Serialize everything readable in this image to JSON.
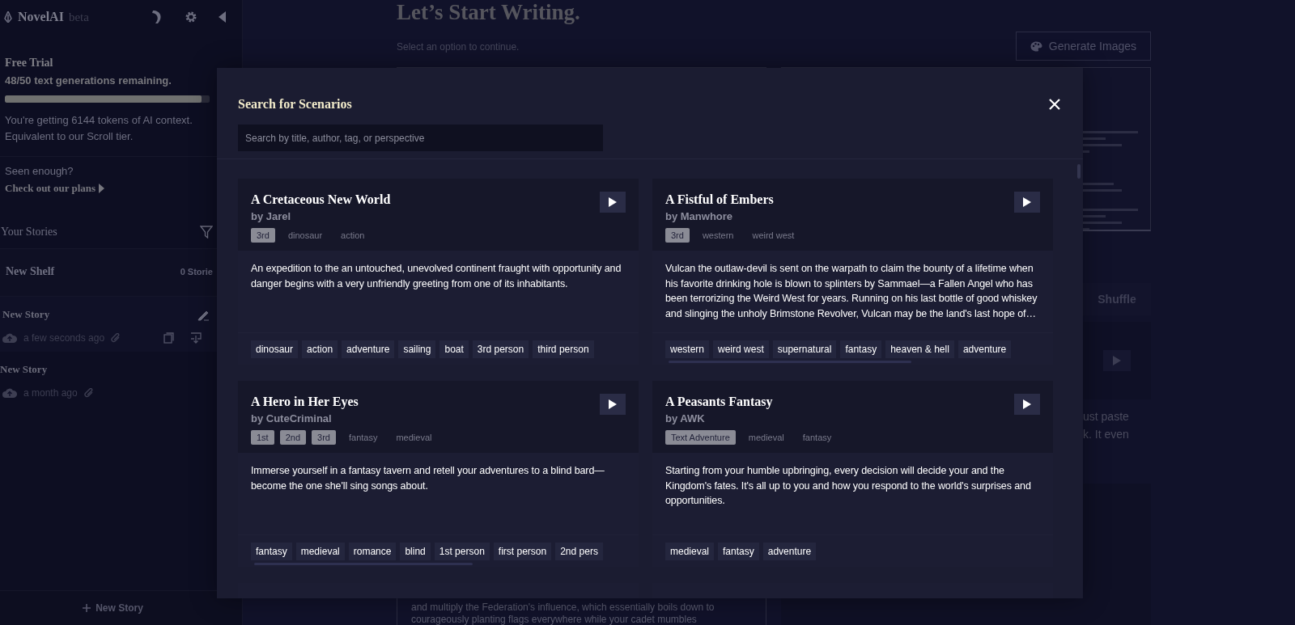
{
  "sidebar": {
    "brand": "NovelAI",
    "brand_badge": "beta",
    "trial": {
      "title": "Free Trial",
      "remaining": "48/50 text generations remaining.",
      "level": 0.96,
      "context": "You're getting 6144 tokens of AI context. Equivalent to our Scroll tier.",
      "prompt": "Seen enough?",
      "plans_link": "Check out our plans"
    },
    "stories_heading": "Your Stories",
    "shelf": {
      "name": "New Shelf",
      "count": "0 Storie"
    },
    "stories": [
      {
        "title": "New Story",
        "time": "a few seconds ago",
        "selected": true
      },
      {
        "title": "New Story",
        "time": "a month ago",
        "selected": false
      }
    ],
    "new_story_button": "New Story"
  },
  "main": {
    "title": "Let’s Start Writing.",
    "subtitle": "Select an option to continue.",
    "generate_images_button": "Generate Images",
    "shuffle_button": "Shuffle",
    "partial_lines": [
      "ust paste",
      "k. It even"
    ],
    "scenario_excerpt": [
      "and multiply the Federation's influence, which essentially boils down to",
      "courageously planting flags everywhere while your cadet mumbles"
    ]
  },
  "modal": {
    "title": "Search for Scenarios",
    "search": {
      "placeholder": "Search by title, author, tag, or perspective"
    },
    "scenarios": [
      {
        "title": "A Cretaceous New World",
        "author": "by Jarel",
        "perspectives": [
          "3rd"
        ],
        "header_tags": [
          "dinosaur",
          "action"
        ],
        "description": "An expedition to the an untouched, unevolved continent fraught with opportunity and danger begins with a very unfriendly greeting from one of its inhabitants.",
        "tags": [
          "dinosaur",
          "action",
          "adventure",
          "sailing",
          "boat",
          "3rd person",
          "third person"
        ]
      },
      {
        "title": "A Fistful of Embers",
        "author": "by Manwhore",
        "perspectives": [
          "3rd"
        ],
        "header_tags": [
          "western",
          "weird west"
        ],
        "description": "Vulcan the outlaw-devil is sent on the warpath to claim the bounty of a lifetime when his favorite drinking hole is blown to splinters by Sammael—a Fallen Angel who has been terrorizing the Weird West for years. Running on his last bottle of good whiskey and slinging the unholy Brimstone Revolver, Vulcan may be the land's last hope of…",
        "tags": [
          "western",
          "weird west",
          "supernatural",
          "fantasy",
          "heaven & hell",
          "adventure"
        ]
      },
      {
        "title": "A Hero in Her Eyes",
        "author": "by CuteCriminal",
        "perspectives": [
          "1st",
          "2nd",
          "3rd"
        ],
        "header_tags": [
          "fantasy",
          "medieval"
        ],
        "description": "Immerse yourself in a fantasy tavern and retell your adventures to a blind bard—become the one she'll sing songs about.",
        "tags": [
          "fantasy",
          "medieval",
          "romance",
          "blind",
          "1st person",
          "first person",
          "2nd pers"
        ]
      },
      {
        "title": "A Peasants Fantasy",
        "author": "by AWK",
        "perspectives": [
          "Text Adventure"
        ],
        "header_tags": [
          "medieval",
          "fantasy"
        ],
        "description": "Starting from your humble upbringing, every decision will decide your and the Kingdom's fates. It's all up to you and how you respond to the world's surprises and opportunities.",
        "tags": [
          "medieval",
          "fantasy",
          "adventure"
        ]
      }
    ]
  }
}
